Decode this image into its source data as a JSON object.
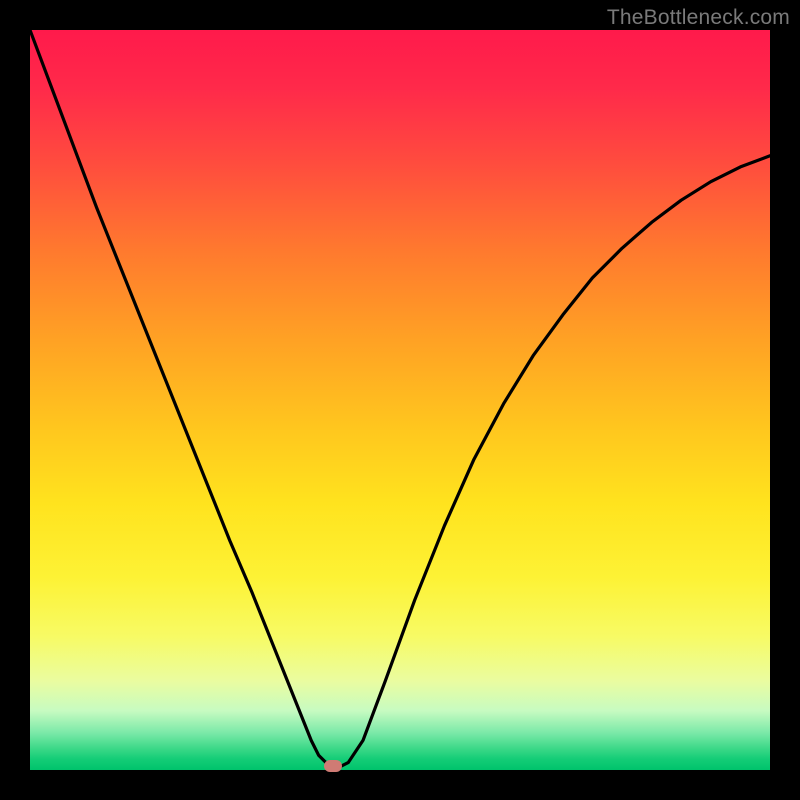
{
  "attribution": "TheBottleneck.com",
  "marker": {
    "color": "#cf7b74"
  },
  "chart_data": {
    "type": "line",
    "title": "",
    "xlabel": "",
    "ylabel": "",
    "xlim": [
      0,
      100
    ],
    "ylim": [
      0,
      100
    ],
    "x": [
      0,
      3,
      6,
      9,
      12,
      15,
      18,
      21,
      24,
      27,
      30,
      32,
      34,
      36,
      37,
      38,
      39,
      40,
      41,
      42,
      43,
      45,
      48,
      52,
      56,
      60,
      64,
      68,
      72,
      76,
      80,
      84,
      88,
      92,
      96,
      100
    ],
    "values": [
      100,
      92,
      84,
      76,
      68.5,
      61,
      53.5,
      46,
      38.5,
      31,
      24,
      19,
      14,
      9,
      6.5,
      4,
      2,
      1,
      0.5,
      0.5,
      1,
      4,
      12,
      23,
      33,
      42,
      49.5,
      56,
      61.5,
      66.5,
      70.5,
      74,
      77,
      79.5,
      81.5,
      83
    ],
    "sweet_spot_x": 41,
    "sweet_spot_y": 0.5,
    "gradient_stops": [
      {
        "pos": 0,
        "color": "#ff1a4b"
      },
      {
        "pos": 0.5,
        "color": "#ffd21e"
      },
      {
        "pos": 0.96,
        "color": "#d4fcb8"
      },
      {
        "pos": 1.0,
        "color": "#00c36c"
      }
    ]
  }
}
